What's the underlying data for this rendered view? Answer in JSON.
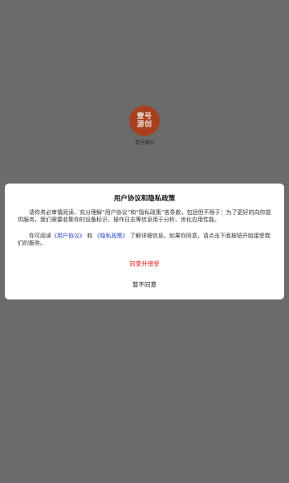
{
  "splash": {
    "logo_line1": "壹号",
    "logo_line2": "源创",
    "app_name": "壹号源创"
  },
  "dialog": {
    "title": "用户协议和隐私政策",
    "para1": "请你务必审慎阅读、充分理解“用户协议”和“隐私政策”各条款，包括但不限于：为了更好的向你提供服务，我们需要收集你的设备标识、操作日志等信息用于分析、优化应用性能。",
    "para2_prefix": "你可阅读",
    "user_agreement_link": "《用户协议》",
    "para2_and": "和",
    "privacy_policy_link": "《隐私政策》",
    "para2_suffix": "了解详细信息。如果你同意，请点击下面按钮开始接受我们的服务。",
    "agree_label": "同意并接受",
    "disagree_label": "暂不同意"
  },
  "colors": {
    "backdrop": "#6b6b6b",
    "logo_bg": "#a8401f",
    "link": "#2a40c8",
    "agree": "#e0201c"
  }
}
